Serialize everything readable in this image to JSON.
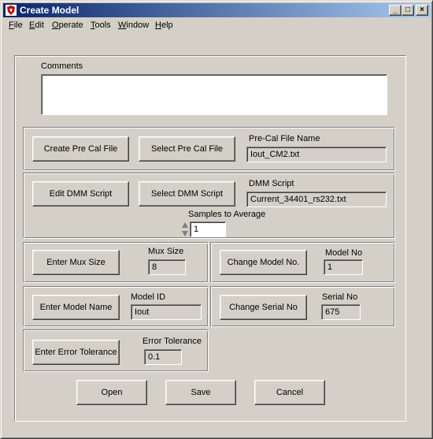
{
  "window": {
    "title": "Create Model",
    "controls": {
      "minimize": "_",
      "maximize": "□",
      "close": "×"
    }
  },
  "menu": [
    "File",
    "Edit",
    "Operate",
    "Tools",
    "Window",
    "Help"
  ],
  "comments": {
    "label": "Comments",
    "value": ""
  },
  "precal": {
    "create_button": "Create Pre Cal File",
    "select_button": "Select Pre Cal File",
    "label": "Pre-Cal File Name",
    "value": "Iout_CM2.txt"
  },
  "dmm": {
    "edit_button": "Edit DMM Script",
    "select_button": "Select DMM Script",
    "label": "DMM Script",
    "value": "Current_34401_rs232.txt",
    "samples_label": "Samples to Average",
    "samples_value": "1"
  },
  "mux": {
    "button": "Enter Mux Size",
    "label": "Mux Size",
    "value": "8"
  },
  "model_no": {
    "button": "Change Model No.",
    "label": "Model No",
    "value": "1"
  },
  "model_id": {
    "button": "Enter Model Name",
    "label": "Model ID",
    "value": "Iout"
  },
  "serial": {
    "button": "Change Serial No",
    "label": "Serial No",
    "value": "675"
  },
  "tolerance": {
    "button": "Enter Error Tolerance",
    "label": "Error Tolerance",
    "value": "0.1"
  },
  "actions": {
    "open": "Open",
    "save": "Save",
    "cancel": "Cancel"
  },
  "colors": {
    "face": "#d4d0c8",
    "title_start": "#0a246a",
    "title_end": "#a6caf0"
  }
}
